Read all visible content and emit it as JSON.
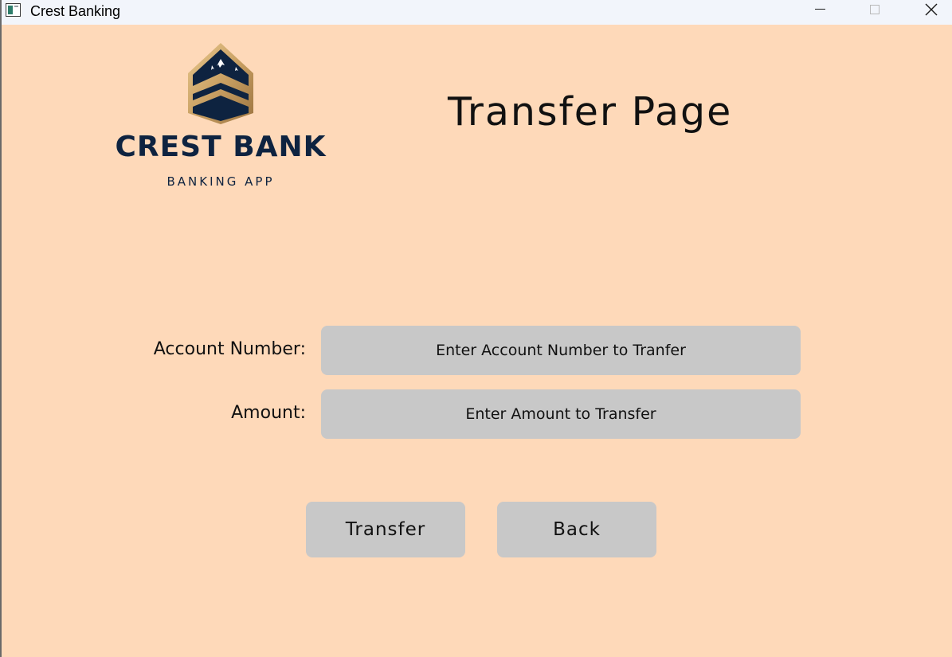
{
  "window": {
    "title": "Crest Banking"
  },
  "logo": {
    "name": "CREST BANK",
    "tagline": "BANKING APP"
  },
  "page": {
    "title": "Transfer Page",
    "background_color": "#FED9B9"
  },
  "form": {
    "account_label": "Account Number:",
    "account_placeholder": "Enter Account Number to Tranfer",
    "amount_label": "Amount:",
    "amount_placeholder": "Enter Amount to Transfer"
  },
  "actions": {
    "transfer_label": "Transfer",
    "back_label": "Back"
  },
  "icons": {
    "app": "app-window-icon",
    "minimize": "minimize-icon",
    "maximize": "maximize-icon",
    "close": "close-icon",
    "logo_emblem": "mountain-chevron-emblem"
  },
  "colors": {
    "brand_navy": "#0E2340",
    "brand_gold": "#C9A063",
    "control_gray": "#C8C8C8"
  }
}
